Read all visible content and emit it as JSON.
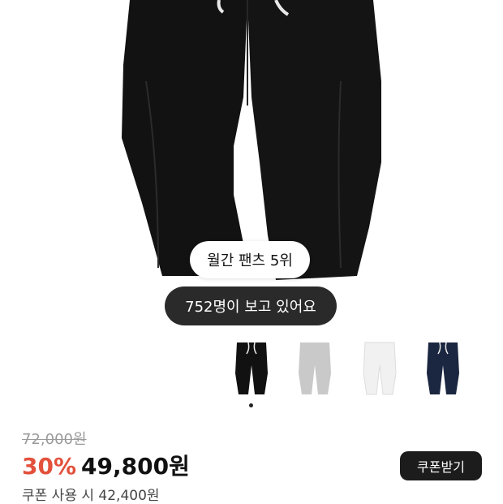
{
  "badges": {
    "rank": "월간 팬츠 5위",
    "viewers": "752명이 보고 있어요"
  },
  "colors": {
    "discount": "#e3513c",
    "button_bg": "#1c1c1c",
    "options": [
      "#111111",
      "#c9c9c9",
      "#f1f1f1",
      "#1b2640"
    ]
  },
  "color_options": [
    {
      "name": "black"
    },
    {
      "name": "gray"
    },
    {
      "name": "white"
    },
    {
      "name": "navy"
    }
  ],
  "price": {
    "original": "72,000원",
    "discount": "30%",
    "final": "49,800원",
    "coupon_text": "쿠폰 사용 시 42,400원"
  },
  "coupon_button": "쿠폰받기"
}
